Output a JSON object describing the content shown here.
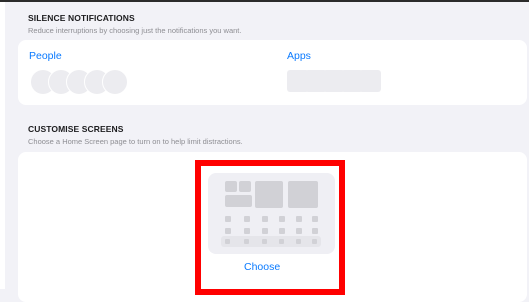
{
  "silence": {
    "title": "SILENCE NOTIFICATIONS",
    "subtitle": "Reduce interruptions by choosing just the notifications you want.",
    "people_label": "People",
    "apps_label": "Apps"
  },
  "customise": {
    "title": "CUSTOMISE SCREENS",
    "subtitle": "Choose a Home Screen page to turn on to help limit distractions.",
    "choose_label": "Choose"
  },
  "colors": {
    "accent": "#0a7aff",
    "highlight": "#ff0000",
    "background": "#f2f2f7"
  }
}
